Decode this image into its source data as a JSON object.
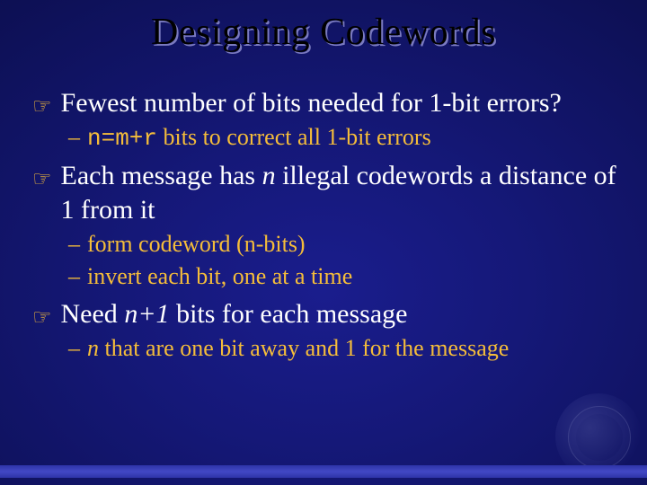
{
  "title": "Designing Codewords",
  "b1": {
    "a": "Fewest number of bits needed for 1-bit errors?",
    "a_sub1_code": "n=m+r",
    "a_sub1_rest": " bits to correct all 1-bit errors",
    "b_pre": "Each message has ",
    "b_ital": "n",
    "b_post": " illegal codewords a distance of 1 from it",
    "b_sub1": "form codeword (n-bits)",
    "b_sub2": "invert each bit, one at a time",
    "c_pre": "Need ",
    "c_ital": "n+1",
    "c_post": " bits for each message",
    "c_sub1_pre": "",
    "c_sub1_ital": "n",
    "c_sub1_post": " that are one bit away and 1 for the message"
  },
  "dash": "–",
  "hand": "☞"
}
